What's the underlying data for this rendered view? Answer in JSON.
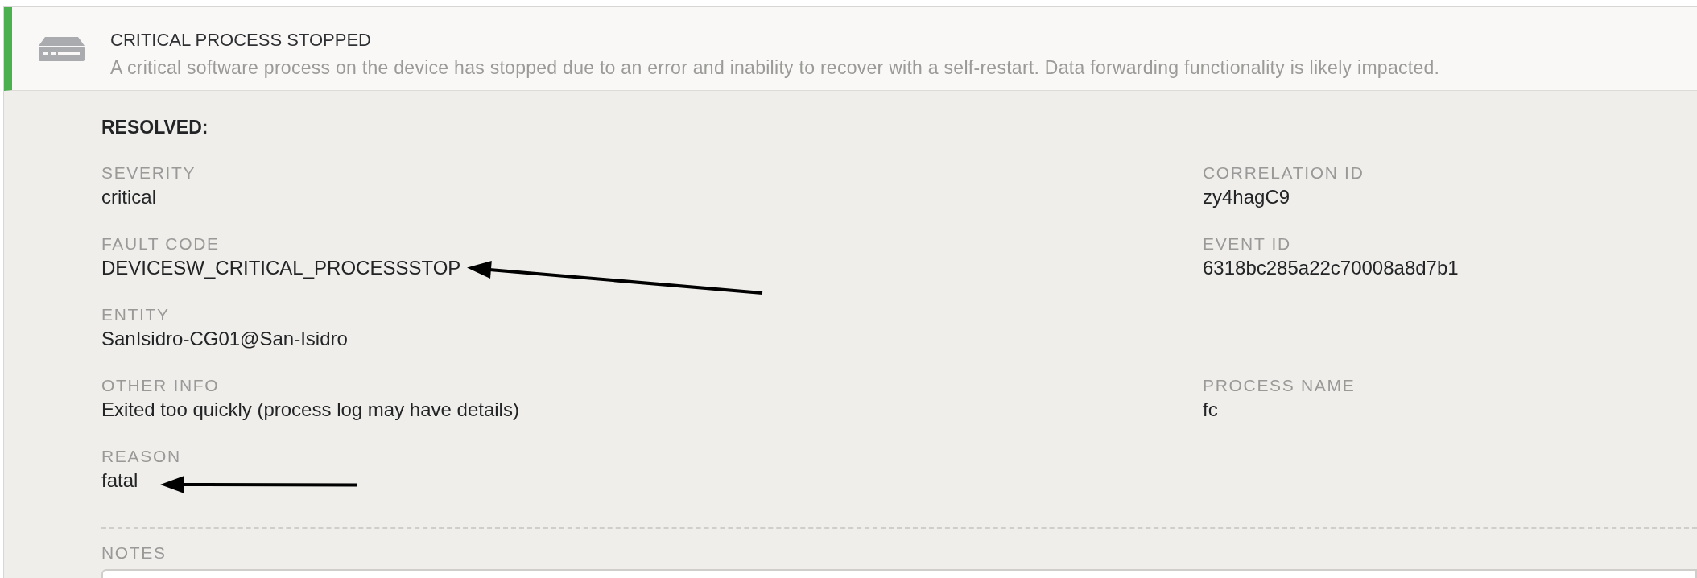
{
  "alert": {
    "title": "CRITICAL PROCESS STOPPED",
    "description": "A critical software process on the device has stopped due to an error and inability to recover with a self-restart. Data forwarding functionality is likely impacted."
  },
  "details": {
    "status_heading": "RESOLVED:",
    "rows": [
      {
        "left": {
          "label": "SEVERITY",
          "value": "critical"
        },
        "right": {
          "label": "CORRELATION ID",
          "value": "zy4hagC9"
        }
      },
      {
        "left": {
          "label": "FAULT CODE",
          "value": "DEVICESW_CRITICAL_PROCESSSTOP"
        },
        "right": {
          "label": "EVENT ID",
          "value": "6318bc285a22c70008a8d7b1"
        }
      },
      {
        "left": {
          "label": "ENTITY",
          "value": "SanIsidro-CG01@San-Isidro"
        }
      },
      {
        "left": {
          "label": "OTHER INFO",
          "value": "Exited too quickly (process log may have details)"
        },
        "right": {
          "label": "PROCESS NAME",
          "value": "fc"
        }
      },
      {
        "left": {
          "label": "REASON",
          "value": "fatal"
        }
      }
    ]
  },
  "notes": {
    "label": "NOTES"
  }
}
